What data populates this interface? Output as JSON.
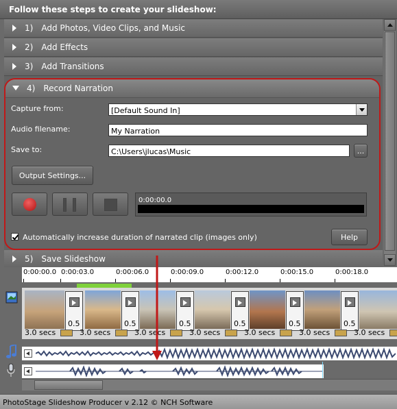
{
  "steps_title": "Follow these steps to create your slideshow:",
  "steps": [
    {
      "num": "1)",
      "label": "Add Photos, Video Clips, and Music"
    },
    {
      "num": "2)",
      "label": "Add Effects"
    },
    {
      "num": "3)",
      "label": "Add Transitions"
    },
    {
      "num": "4)",
      "label": "Record Narration"
    },
    {
      "num": "5)",
      "label": "Save Slideshow"
    }
  ],
  "narration": {
    "capture_label": "Capture from:",
    "capture_value": "[Default Sound In]",
    "filename_label": "Audio filename:",
    "filename_value": "My Narration",
    "saveto_label": "Save to:",
    "saveto_value": "C:\\Users\\jlucas\\Music",
    "browse_label": "...",
    "output_settings_label": "Output Settings...",
    "timecode": "0:00:00.0",
    "auto_increase_label": "Automatically increase duration of narrated clip (images only)",
    "auto_increase_checked": true,
    "help_label": "Help"
  },
  "timeline": {
    "ruler_labels": [
      "0:00:00.0",
      "0:00:03.0",
      "0:00:06.0",
      "0:00:09.0",
      "0:00:12.0",
      "0:00:15.0",
      "0:00:18.0"
    ],
    "clip_durations": [
      "3.0 secs",
      "3.0 secs",
      "3.0 secs",
      "3.0 secs",
      "3.0 secs",
      "3.0 secs",
      "3.0 secs"
    ],
    "transition_values": [
      "0.5",
      "0.5",
      "0.5",
      "0.5",
      "0.5",
      "0.5"
    ]
  },
  "status": "PhotoStage Slideshow Producer v 2.12 © NCH Software",
  "colors": {
    "highlight": "#c01818",
    "progress_green": "#7fd13b"
  }
}
